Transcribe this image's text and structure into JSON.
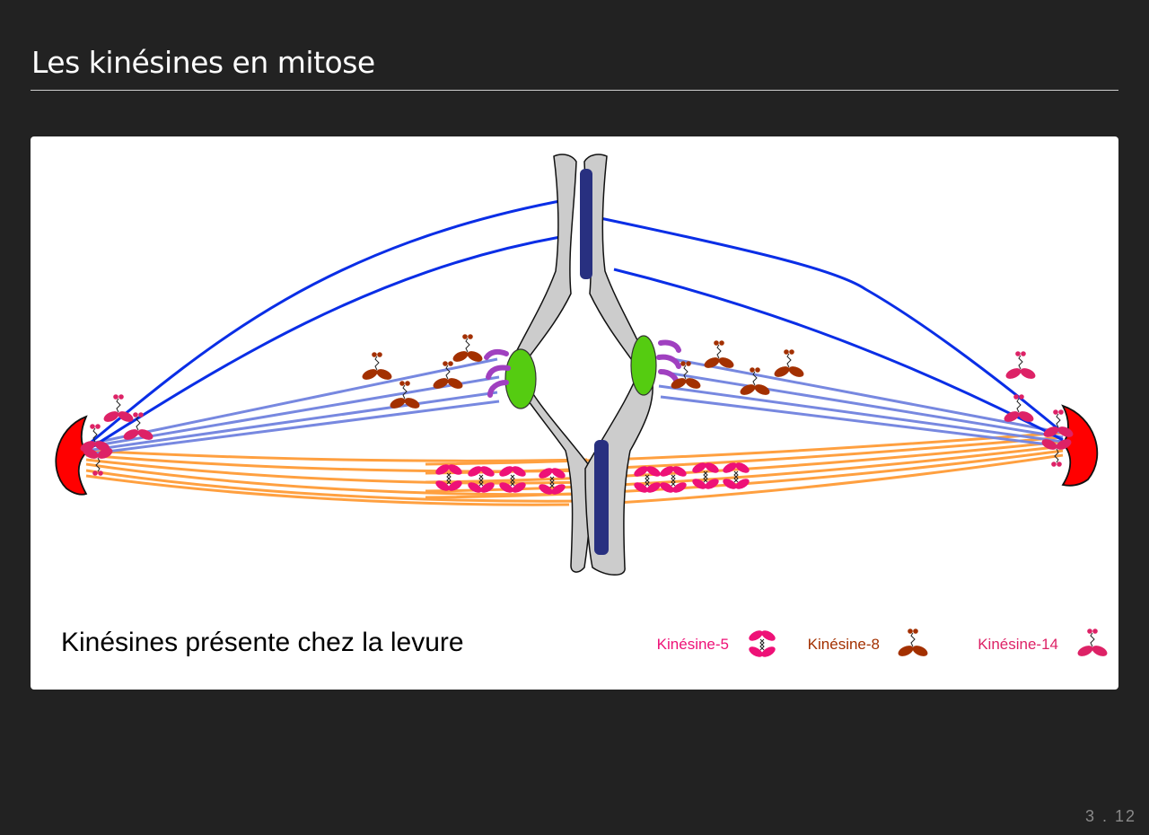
{
  "slide": {
    "title": "Les kinésines en mitose",
    "number": "3 . 12"
  },
  "figure": {
    "caption": "Kinésines présente chez la levure",
    "legend": [
      {
        "label": "Kinésine-5",
        "color": "#ee1177",
        "icon": "kinesin-5-icon"
      },
      {
        "label": "Kinésine-8",
        "color": "#a33000",
        "icon": "kinesin-8-icon"
      },
      {
        "label": "Kinésine-14",
        "color": "#dd2266",
        "icon": "kinesin-14-icon"
      }
    ],
    "colors": {
      "spindle_pole": "#ff0000",
      "kinetochore": "#55cc11",
      "kinetochore_microtubule": "#7788e0",
      "astral_microtubule": "#0a2ee6",
      "interpolar_microtubule": "#ffa040",
      "chromosome": "#cccccc",
      "centromere": "#283080",
      "kinetochore_protein": "#a040c0"
    }
  }
}
